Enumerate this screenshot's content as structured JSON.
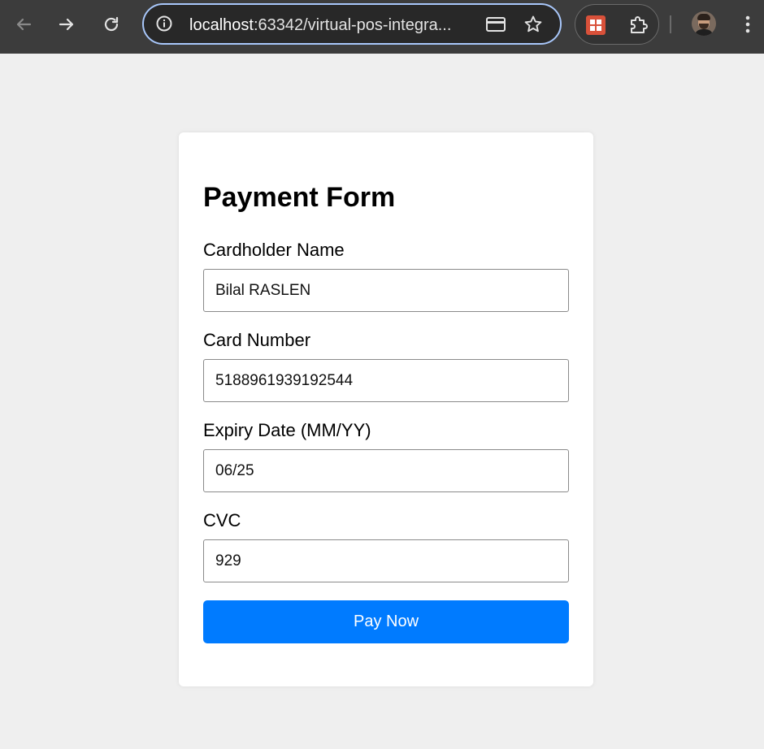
{
  "browser": {
    "url_host": "localhost",
    "url_rest": ":63342/virtual-pos-integra...",
    "icons": {
      "back": "back-arrow-icon",
      "forward": "forward-arrow-icon",
      "reload": "reload-icon",
      "site_info": "info-icon",
      "card": "credit-card-icon",
      "bookmark": "star-icon",
      "extension_office": "office-extension-icon",
      "extensions": "puzzle-icon",
      "profile": "avatar",
      "menu": "kebab-menu-icon"
    },
    "accent_color": "#a8c7fa"
  },
  "form": {
    "title": "Payment Form",
    "fields": [
      {
        "label": "Cardholder Name",
        "value": "Bilal RASLEN"
      },
      {
        "label": "Card Number",
        "value": "5188961939192544"
      },
      {
        "label": "Expiry Date (MM/YY)",
        "value": "06/25"
      },
      {
        "label": "CVC",
        "value": "929"
      }
    ],
    "submit_label": "Pay Now",
    "submit_color": "#007bff"
  }
}
